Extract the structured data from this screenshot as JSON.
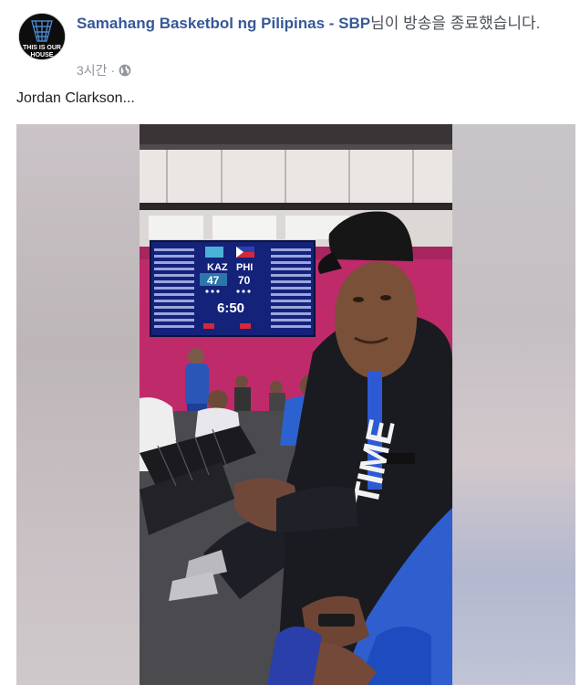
{
  "post": {
    "author": "Samahang Basketbol ng Pilipinas - SBP",
    "action_text": "님이 방송을 종료했습니다.",
    "time": "3시간",
    "separator": "·",
    "privacy_icon": "globe-icon",
    "text": "Jordan Clarkson...",
    "avatar_logo_text": "THIS IS OUR HOUSE"
  },
  "scoreboard": {
    "home_team": "KAZ",
    "away_team": "PHI",
    "home_score": "47",
    "away_score": "70",
    "clock": "6:50"
  },
  "jersey": {
    "print": "TIME"
  },
  "colors": {
    "link": "#365899",
    "meta": "#90949c",
    "text": "#1c1e21",
    "scoreboard_bg": "#14227a"
  }
}
